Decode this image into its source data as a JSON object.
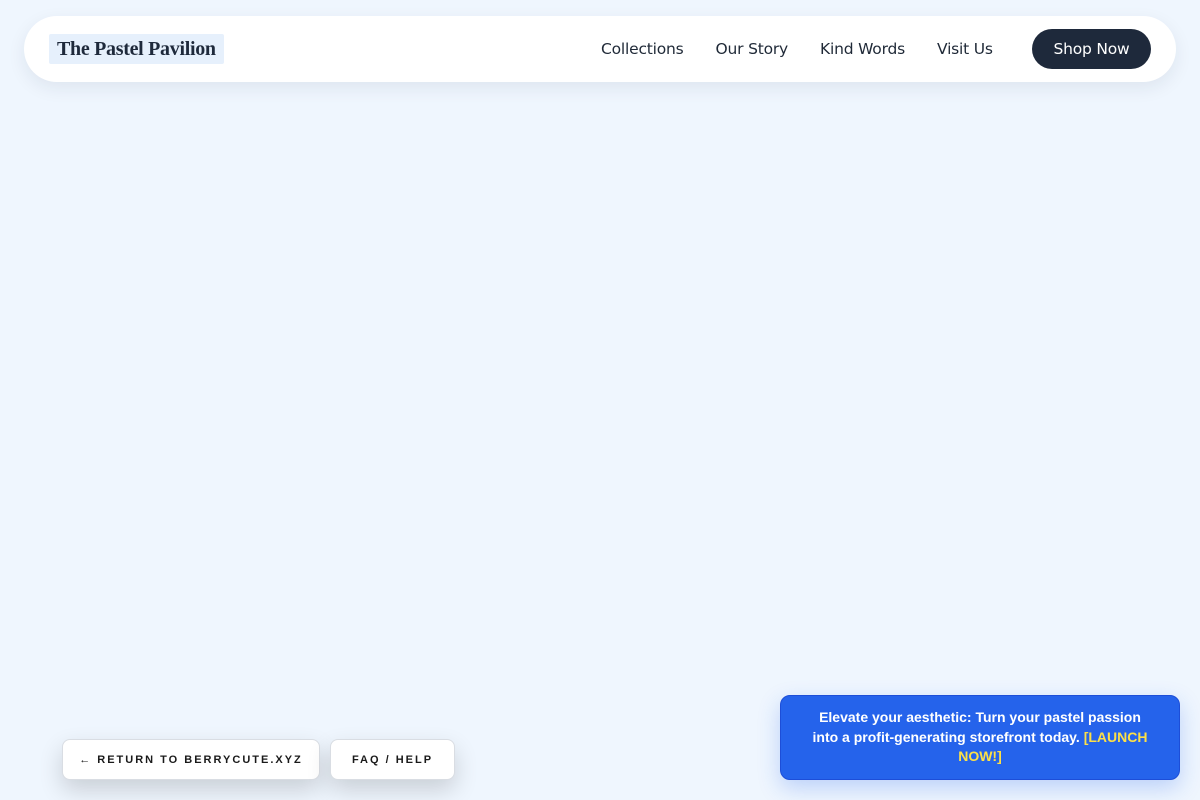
{
  "header": {
    "brand": "The Pastel Pavilion",
    "nav": [
      {
        "label": "Collections"
      },
      {
        "label": "Our Story"
      },
      {
        "label": "Kind Words"
      },
      {
        "label": "Visit Us"
      }
    ],
    "cta_label": "Shop Now"
  },
  "footer_buttons": {
    "return_label": "← RETURN TO BERRYCUTE.XYZ",
    "faq_label": "FAQ / HELP"
  },
  "promo": {
    "text": "Elevate your aesthetic: Turn your pastel passion into a profit-generating storefront today.",
    "cta": "[LAUNCH NOW!]"
  },
  "colors": {
    "page_background": "#eff6fe",
    "nav_background": "#ffffff",
    "cta_background": "#1e293b",
    "promo_background": "#2563eb",
    "promo_cta": "#fde047"
  }
}
